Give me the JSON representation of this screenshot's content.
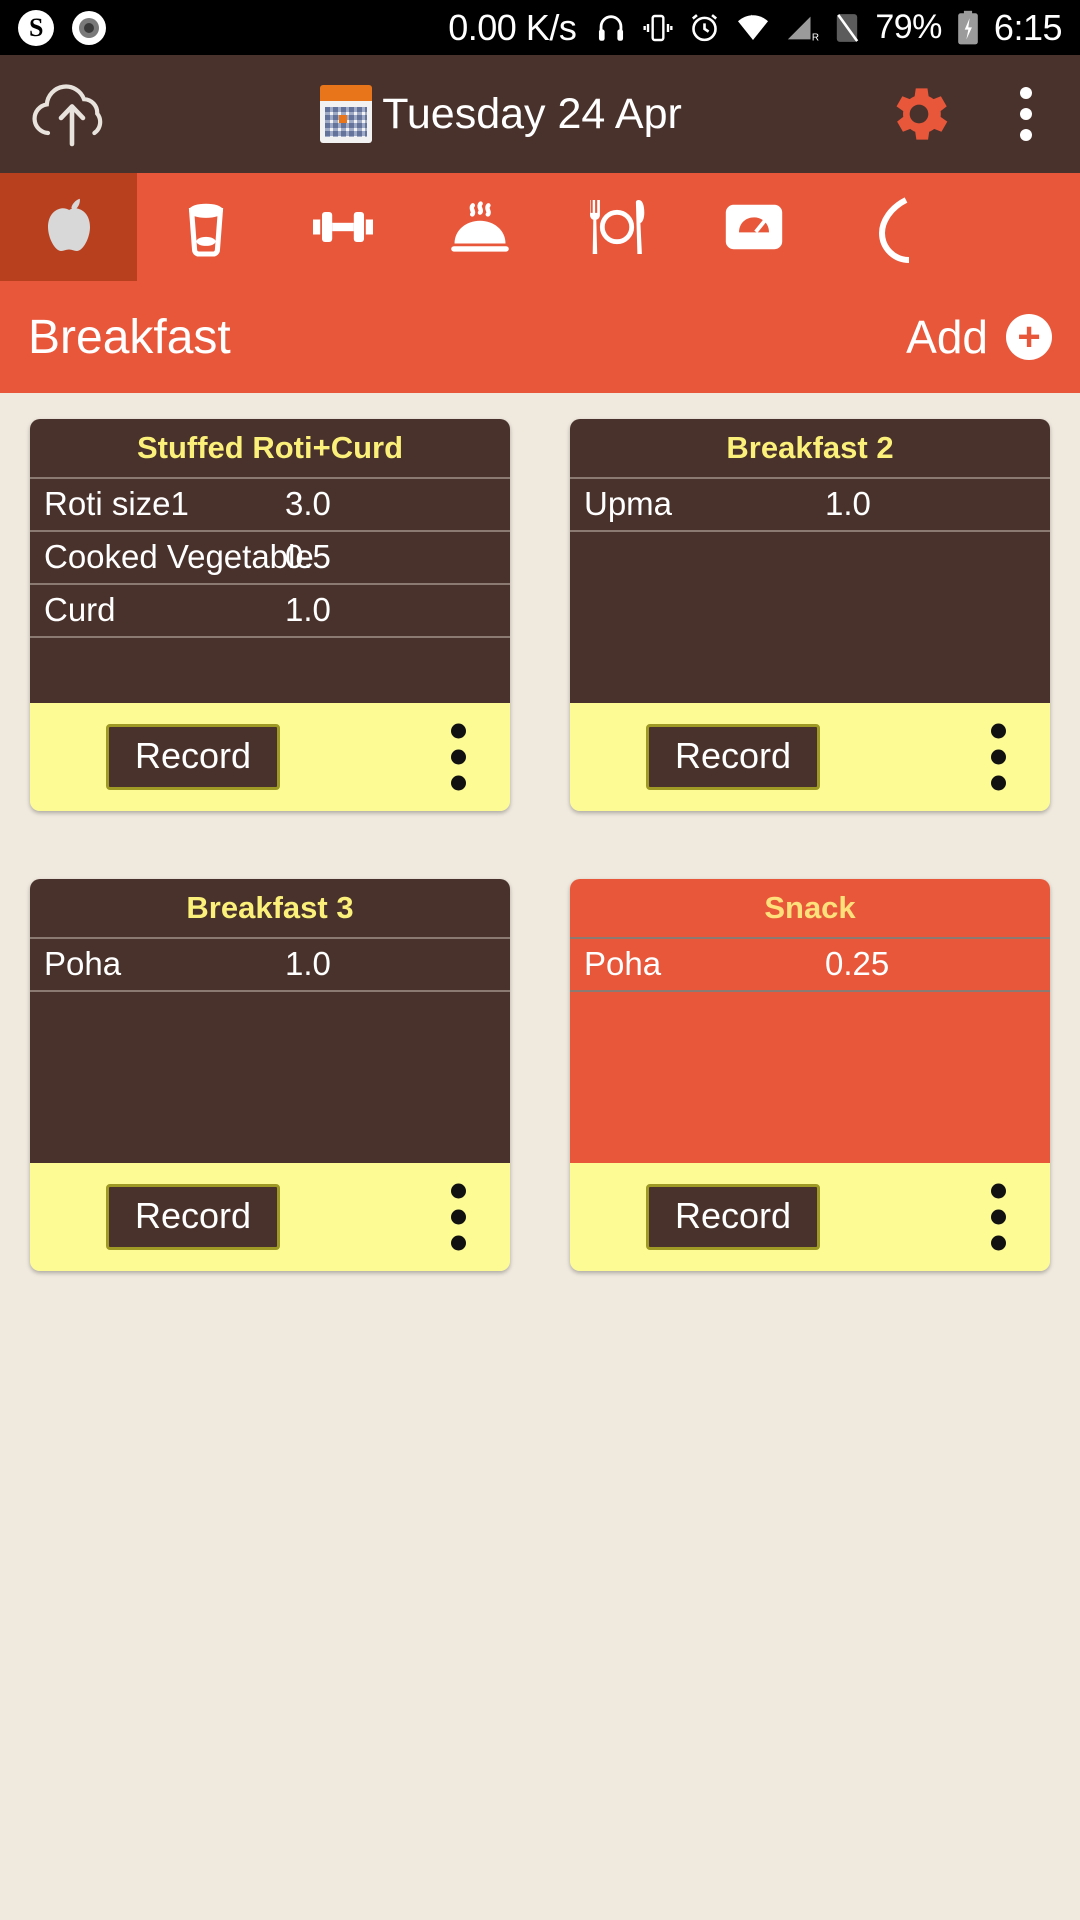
{
  "status_bar": {
    "left_icons": [
      "skype-icon",
      "screen-record-icon"
    ],
    "skype_letter": "S",
    "network_speed": "0.00 K/s",
    "icons": [
      "headphone-icon",
      "vibrate-icon",
      "alarm-icon",
      "wifi-icon",
      "signal-icon",
      "sim-icon"
    ],
    "signal_label": "R",
    "battery_percent": "79%",
    "battery_state": "charging-battery-icon",
    "time": "6:15"
  },
  "app_bar": {
    "cloud_upload_icon": "cloud-upload-icon",
    "calendar_icon": "calendar-icon",
    "title": "Tuesday 24 Apr",
    "settings_icon": "gear-icon",
    "overflow_icon": "overflow-menu-icon"
  },
  "tabs": [
    {
      "name": "apple-tab",
      "icon": "apple-icon",
      "selected": true
    },
    {
      "name": "drink-tab",
      "icon": "glass-icon",
      "selected": false
    },
    {
      "name": "exercise-tab",
      "icon": "dumbbell-icon",
      "selected": false
    },
    {
      "name": "cooked-dish-tab",
      "icon": "cloche-icon",
      "selected": false
    },
    {
      "name": "meal-tab",
      "icon": "fork-plate-knife-icon",
      "selected": false
    },
    {
      "name": "weight-tab",
      "icon": "weight-scale-icon",
      "selected": false
    },
    {
      "name": "more-tab",
      "icon": "partial-icon",
      "selected": false
    }
  ],
  "section": {
    "title": "Breakfast",
    "add_label": "Add",
    "add_icon": "plus-circle-icon"
  },
  "cards": [
    {
      "title": "Stuffed Roti+Curd",
      "theme": "brown",
      "rows": [
        {
          "name": "Roti size1",
          "value": "3.0"
        },
        {
          "name": "Cooked Vegetable",
          "value": "0.5"
        },
        {
          "name": "Curd",
          "value": "1.0"
        }
      ],
      "record_label": "Record",
      "menu_icon": "overflow-menu-icon"
    },
    {
      "title": "Breakfast 2",
      "theme": "brown",
      "rows": [
        {
          "name": "Upma",
          "value": "1.0"
        }
      ],
      "record_label": "Record",
      "menu_icon": "overflow-menu-icon"
    },
    {
      "title": "Breakfast 3",
      "theme": "brown",
      "rows": [
        {
          "name": "Poha",
          "value": "1.0"
        }
      ],
      "record_label": "Record",
      "menu_icon": "overflow-menu-icon"
    },
    {
      "title": "Snack",
      "theme": "orange",
      "rows": [
        {
          "name": "Poha",
          "value": "0.25"
        }
      ],
      "record_label": "Record",
      "menu_icon": "overflow-menu-icon"
    }
  ],
  "colors": {
    "accent_orange": "#E8573A",
    "dark_brown": "#4A322C",
    "selected_tab": "#B8401F",
    "page_background": "#EFE9DE",
    "footer_yellow": "#FCFB94",
    "title_yellow": "#FAF07A"
  }
}
